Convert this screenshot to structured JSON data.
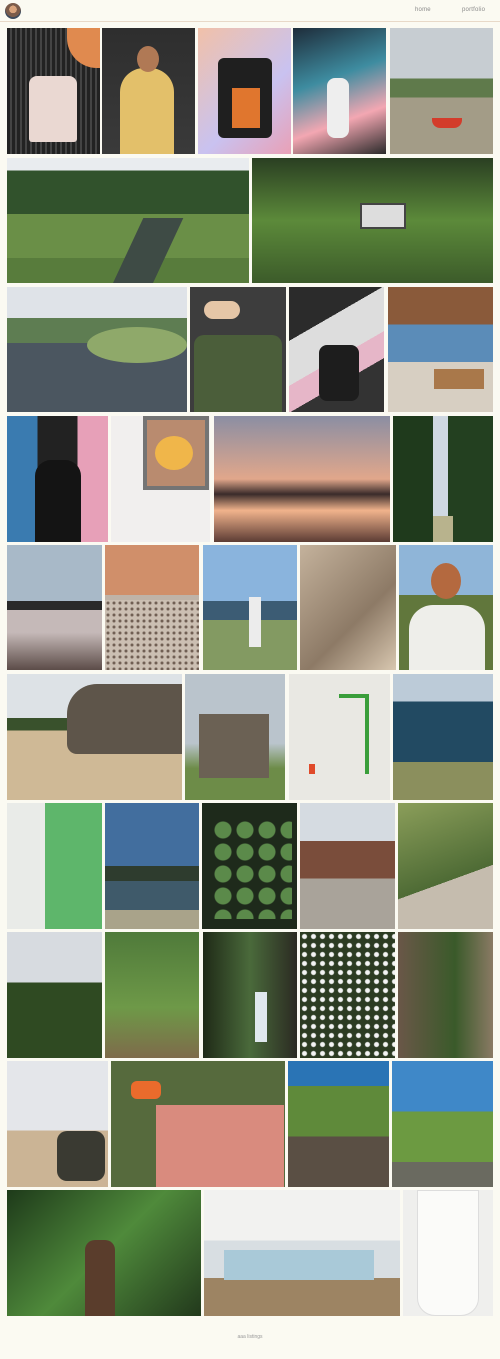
{
  "nav": {
    "home_label": "home",
    "portfolio_label": "portfolio"
  },
  "footer": {
    "text": "aaa listings"
  },
  "photos": [
    {
      "icon": "t-shirt-on-hanger"
    },
    {
      "icon": "person-yellow-hoodie"
    },
    {
      "icon": "printed-shirt-mural"
    },
    {
      "icon": "mural-figure"
    },
    {
      "icon": "harbour-boats"
    },
    {
      "icon": "wetland-river"
    },
    {
      "icon": "overgrown-gate"
    },
    {
      "icon": "coastal-inlet"
    },
    {
      "icon": "green-jacket"
    },
    {
      "icon": "couple-mural"
    },
    {
      "icon": "picnic-area"
    },
    {
      "icon": "man-adidas-mural"
    },
    {
      "icon": "window-leaf"
    },
    {
      "icon": "sunset-lake"
    },
    {
      "icon": "forest-path"
    },
    {
      "icon": "ripples-lake"
    },
    {
      "icon": "pebble-shore"
    },
    {
      "icon": "coast-walker"
    },
    {
      "icon": "rock-texture"
    },
    {
      "icon": "man-blue-hat"
    },
    {
      "icon": "cliff-rock"
    },
    {
      "icon": "castle-ruins"
    },
    {
      "icon": "white-wall-green"
    },
    {
      "icon": "sea-cliffs"
    },
    {
      "icon": "green-wall"
    },
    {
      "icon": "river-railings"
    },
    {
      "icon": "lily-pads"
    },
    {
      "icon": "town-square"
    },
    {
      "icon": "moss-bench"
    },
    {
      "icon": "tree-silhouette"
    },
    {
      "icon": "woodland-walk"
    },
    {
      "icon": "waterfall-gorge"
    },
    {
      "icon": "white-flowers"
    },
    {
      "icon": "ivy-cliff"
    },
    {
      "icon": "beach-guitar"
    },
    {
      "icon": "picnic-mat"
    },
    {
      "icon": "moorland-valley"
    },
    {
      "icon": "hillside-wall"
    },
    {
      "icon": "jungle-person"
    },
    {
      "icon": "cafe-interior"
    },
    {
      "icon": "white-shirt-dress"
    }
  ]
}
